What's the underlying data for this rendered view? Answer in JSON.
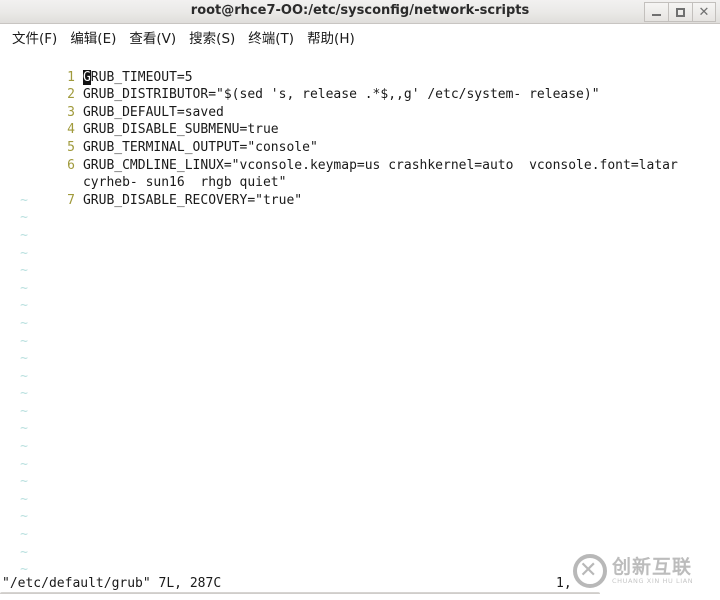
{
  "window": {
    "title": "root@rhce7-OO:/etc/sysconfig/network-scripts",
    "buttons": {
      "minimize": "minimize-icon",
      "maximize": "maximize-icon",
      "close": "close-icon"
    }
  },
  "menubar": {
    "items": [
      {
        "label": "文件(F)",
        "name": "menu-file"
      },
      {
        "label": "编辑(E)",
        "name": "menu-edit"
      },
      {
        "label": "查看(V)",
        "name": "menu-view"
      },
      {
        "label": "搜索(S)",
        "name": "menu-search"
      },
      {
        "label": "终端(T)",
        "name": "menu-terminal"
      },
      {
        "label": "帮助(H)",
        "name": "menu-help"
      }
    ]
  },
  "editor": {
    "cursor_char": "G",
    "lines": [
      {
        "num": "1",
        "text_before_cursor": "",
        "cursor": "G",
        "text": "RUB_TIMEOUT=5"
      },
      {
        "num": "2",
        "text": "GRUB_DISTRIBUTOR=\"$(sed 's, release .*$,,g' /etc/system- release)\""
      },
      {
        "num": "3",
        "text": "GRUB_DEFAULT=saved"
      },
      {
        "num": "4",
        "text": "GRUB_DISABLE_SUBMENU=true"
      },
      {
        "num": "5",
        "text": "GRUB_TERMINAL_OUTPUT=\"console\""
      },
      {
        "num": "6",
        "text": "GRUB_CMDLINE_LINUX=\"vconsole.keymap=us crashkernel=auto  vconsole.font=latar"
      },
      {
        "num": "",
        "text": "cyrheb- sun16  rhgb quiet\""
      },
      {
        "num": "7",
        "text": "GRUB_DISABLE_RECOVERY=\"true\""
      }
    ],
    "empty_marker": "~",
    "empty_line_count": 22
  },
  "statusline": {
    "left": "\"/etc/default/grub\" 7L, 287C",
    "right": "1,"
  },
  "watermark": {
    "cn": "创新互联",
    "en": "CHUANG XIN HU LIAN",
    "logo": "circled-x-logo"
  },
  "colors": {
    "line_number": "#a09a3c",
    "tilde": "#b9e0df",
    "text": "#1a1a1a",
    "cursor_bg": "#111111",
    "cursor_fg": "#ffffff",
    "terminal_bg": "#ffffff",
    "titlebar_bg": "#ebeae8"
  }
}
